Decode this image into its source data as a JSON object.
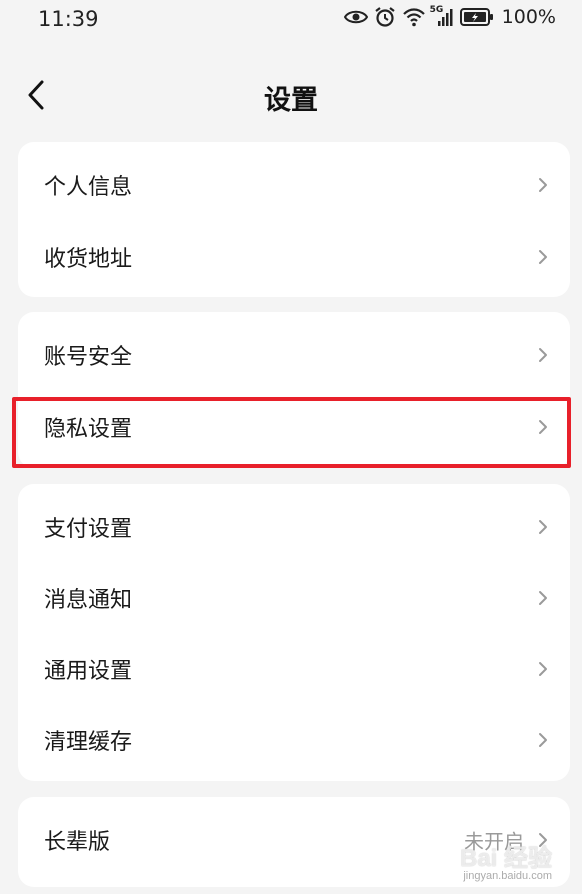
{
  "status_bar": {
    "time": "11:39",
    "network": "5G",
    "battery": "100%"
  },
  "nav": {
    "title": "设置",
    "back_icon": "chevron-left-icon"
  },
  "groups": [
    {
      "items": [
        {
          "label": "个人信息"
        },
        {
          "label": "收货地址"
        }
      ]
    },
    {
      "items": [
        {
          "label": "账号安全"
        },
        {
          "label": "隐私设置"
        }
      ]
    },
    {
      "items": [
        {
          "label": "支付设置"
        },
        {
          "label": "消息通知"
        },
        {
          "label": "通用设置"
        },
        {
          "label": "清理缓存"
        }
      ]
    },
    {
      "items": [
        {
          "label": "长辈版",
          "value": "未开启"
        }
      ]
    }
  ],
  "highlight_color": "#e8202a",
  "watermark": {
    "text": "Bai 经验",
    "sub": "jingyan.baidu.com"
  }
}
